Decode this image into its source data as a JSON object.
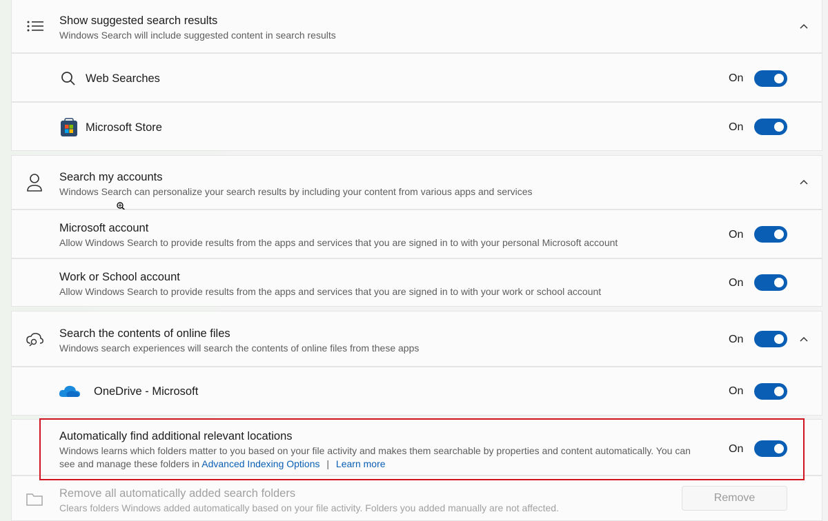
{
  "suggested": {
    "title": "Show suggested search results",
    "desc": "Windows Search will include suggested content in search results",
    "items": [
      {
        "label": "Web Searches",
        "state": "On"
      },
      {
        "label": "Microsoft Store",
        "state": "On"
      }
    ]
  },
  "accounts": {
    "title": "Search my accounts",
    "desc": "Windows Search can personalize your search results by including your content from various apps and services",
    "items": [
      {
        "label": "Microsoft account",
        "desc": "Allow Windows Search to provide results from the apps and services that you are signed in to with your personal Microsoft account",
        "state": "On"
      },
      {
        "label": "Work or School account",
        "desc": "Allow Windows Search to provide results from the apps and services that you are signed in to with your work or school account",
        "state": "On"
      }
    ]
  },
  "online_files": {
    "title": "Search the contents of online files",
    "desc": "Windows search experiences will search the contents of online files from these apps",
    "state": "On",
    "items": [
      {
        "label": "OneDrive - Microsoft",
        "state": "On"
      }
    ]
  },
  "auto_locations": {
    "title": "Automatically find additional relevant locations",
    "desc_line1": "Windows learns which folders matter to you based on your file activity and makes them searchable by properties and content automatically. You can",
    "desc_line2_prefix": "see and manage these folders in",
    "link_advanced": "Advanced Indexing Options",
    "separator": "|",
    "link_learn": "Learn more",
    "state": "On"
  },
  "remove_folders": {
    "title": "Remove all automatically added search folders",
    "desc": "Clears folders Windows added automatically based on your file activity. Folders you added manually are not affected.",
    "button": "Remove"
  },
  "colors": {
    "accent": "#0a5fb4",
    "highlight_border": "#d0131f"
  }
}
